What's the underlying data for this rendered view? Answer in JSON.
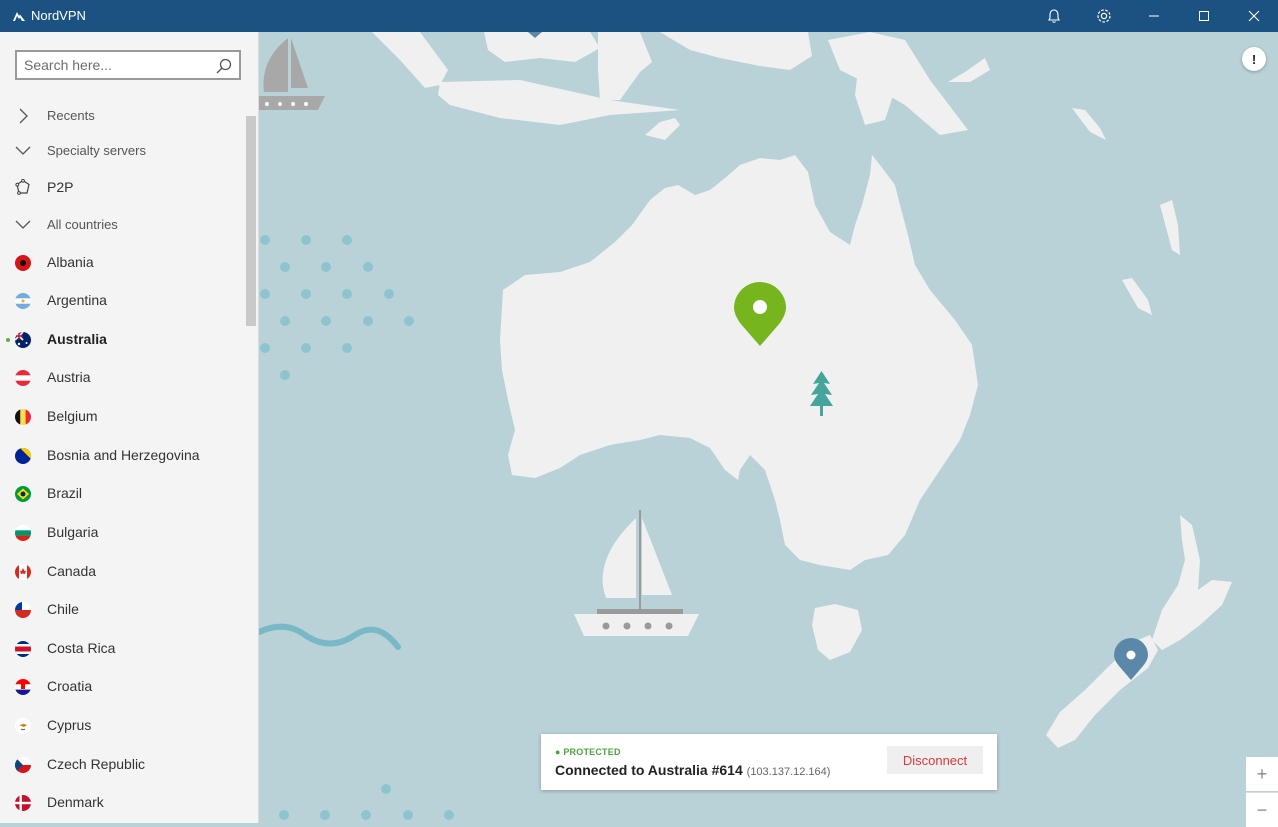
{
  "window": {
    "title": "NordVPN"
  },
  "search": {
    "placeholder": "Search here..."
  },
  "sections": {
    "recents": "Recents",
    "specialty": "Specialty servers",
    "p2p": "P2P",
    "all_countries": "All countries"
  },
  "countries": [
    {
      "label": "Albania"
    },
    {
      "label": "Argentina"
    },
    {
      "label": "Australia"
    },
    {
      "label": "Austria"
    },
    {
      "label": "Belgium"
    },
    {
      "label": "Bosnia and Herzegovina"
    },
    {
      "label": "Brazil"
    },
    {
      "label": "Bulgaria"
    },
    {
      "label": "Canada"
    },
    {
      "label": "Chile"
    },
    {
      "label": "Costa Rica"
    },
    {
      "label": "Croatia"
    },
    {
      "label": "Cyprus"
    },
    {
      "label": "Czech Republic"
    },
    {
      "label": "Denmark"
    }
  ],
  "active_country": "Australia",
  "status": {
    "state": "PROTECTED",
    "connection": "Connected to Australia #614",
    "ip": "(103.137.12.164)",
    "disconnect_label": "Disconnect"
  },
  "map": {
    "info_label": "!",
    "zoom_in": "+",
    "zoom_out": "−"
  },
  "colors": {
    "titlebar": "#1c5282",
    "ocean": "#b9d2d8",
    "land": "#f0f0f0",
    "connected_pin": "#77b51f",
    "pin": "#5b87a8",
    "protected": "#4ba43d",
    "disconnect": "#d9393d"
  }
}
